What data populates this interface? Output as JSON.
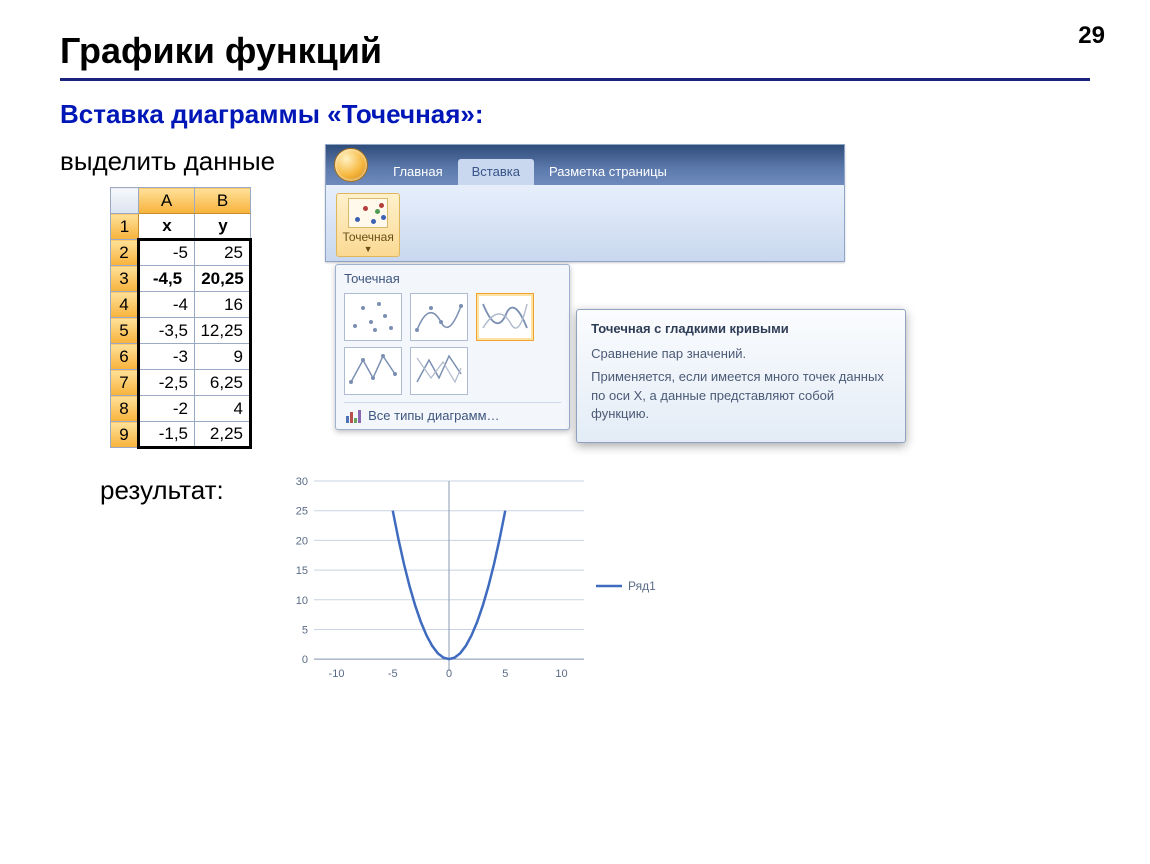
{
  "page_number": "29",
  "title": "Графики функций",
  "subtitle": "Вставка диаграммы «Точечная»:",
  "step1_label": "выделить данные",
  "result_label": "результат:",
  "excel": {
    "col_letters": [
      "A",
      "B"
    ],
    "header_row_num": "1",
    "headers": [
      "x",
      "y"
    ],
    "rows": [
      {
        "n": "2",
        "x": "-5",
        "y": "25"
      },
      {
        "n": "3",
        "x": "-4,5",
        "y": "20,25"
      },
      {
        "n": "4",
        "x": "-4",
        "y": "16"
      },
      {
        "n": "5",
        "x": "-3,5",
        "y": "12,25"
      },
      {
        "n": "6",
        "x": "-3",
        "y": "9"
      },
      {
        "n": "7",
        "x": "-2,5",
        "y": "6,25"
      },
      {
        "n": "8",
        "x": "-2",
        "y": "4"
      },
      {
        "n": "9",
        "x": "-1,5",
        "y": "2,25"
      }
    ]
  },
  "ribbon": {
    "tabs": {
      "home": "Главная",
      "insert": "Вставка",
      "layout": "Разметка страницы"
    },
    "scatter_button": "Точечная",
    "gallery_title": "Точечная",
    "all_charts": "Все типы диаграмм…",
    "tooltip": {
      "title": "Точечная с гладкими кривыми",
      "line1": "Сравнение пар значений.",
      "line2": "Применяется, если имеется много точек данных по оси X, а данные представляют собой функцию."
    }
  },
  "chart_data": {
    "type": "line",
    "series": [
      {
        "name": "Ряд1",
        "x": [
          -5,
          -4.5,
          -4,
          -3.5,
          -3,
          -2.5,
          -2,
          -1.5,
          -1,
          -0.5,
          0,
          0.5,
          1,
          1.5,
          2,
          2.5,
          3,
          3.5,
          4,
          4.5,
          5
        ],
        "y": [
          25,
          20.25,
          16,
          12.25,
          9,
          6.25,
          4,
          2.25,
          1,
          0.25,
          0,
          0.25,
          1,
          2.25,
          4,
          6.25,
          9,
          12.25,
          16,
          20.25,
          25
        ]
      }
    ],
    "x_ticks": [
      -10,
      -5,
      0,
      5,
      10
    ],
    "y_ticks": [
      0,
      5,
      10,
      15,
      20,
      25,
      30
    ],
    "xlim": [
      -12,
      12
    ],
    "ylim": [
      -2,
      30
    ],
    "legend_position": "right",
    "grid": true
  }
}
